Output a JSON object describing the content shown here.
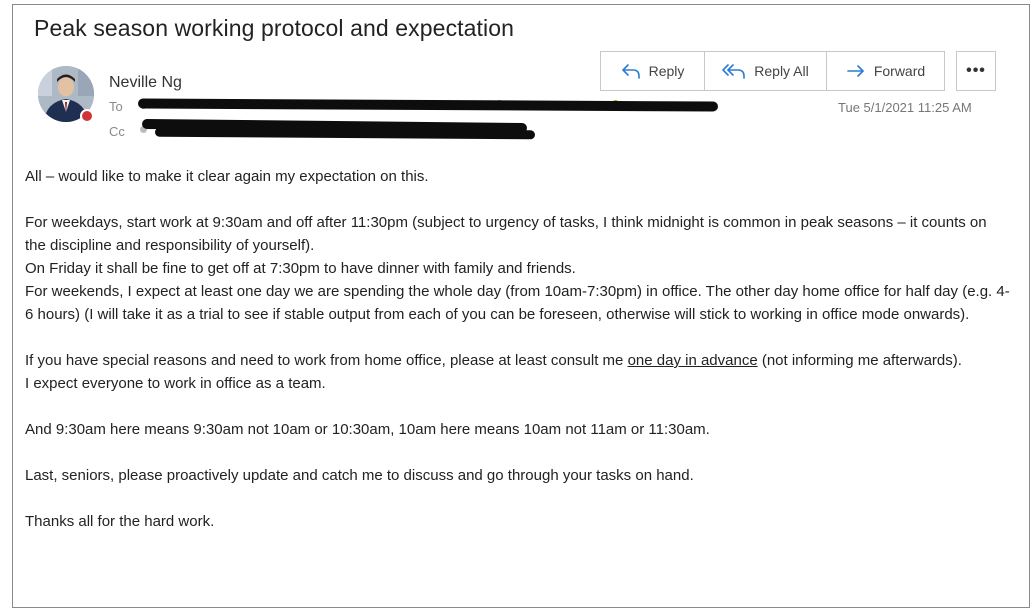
{
  "email": {
    "subject": "Peak season working protocol and expectation",
    "sender": "Neville Ng",
    "to_label": "To",
    "cc_label": "Cc",
    "date": "Tue 5/1/2021 11:25 AM",
    "avatar_presence_color": "#d13438"
  },
  "actions": {
    "reply": "Reply",
    "reply_all": "Reply All",
    "forward": "Forward",
    "more": "•••",
    "icon_color": "#2b7cd3"
  },
  "body": {
    "line1": "All – would like to make it clear again my expectation on this.",
    "p2a": "For weekdays, start work at 9:30am and off after 11:30pm (subject to urgency of tasks, I think midnight is common in peak seasons – it counts on the discipline and responsibility of yourself).",
    "p2b": "On Friday it shall be fine to get off at 7:30pm to have dinner with family and friends.",
    "p2c": "For weekends, I expect at least one day we are spending the whole day (from 10am-7:30pm) in office. The other day home office for half day (e.g. 4-6 hours) (I will take it as a trial to see if stable output from each of you can be foreseen, otherwise will stick to working in office mode onwards).",
    "p3a_pre": "If you have special reasons and need to work from home office, please at least consult me ",
    "p3a_ul": "one day in advance",
    "p3a_post": " (not informing me afterwards).",
    "p3b": "I expect everyone to work in office as a team.",
    "p4": "And 9:30am here means 9:30am not 10am or 10:30am, 10am here means 10am not 11am or 11:30am.",
    "p5": "Last, seniors, please proactively update and catch me to discuss and go through your tasks on hand.",
    "p6": "Thanks all for the hard work."
  }
}
